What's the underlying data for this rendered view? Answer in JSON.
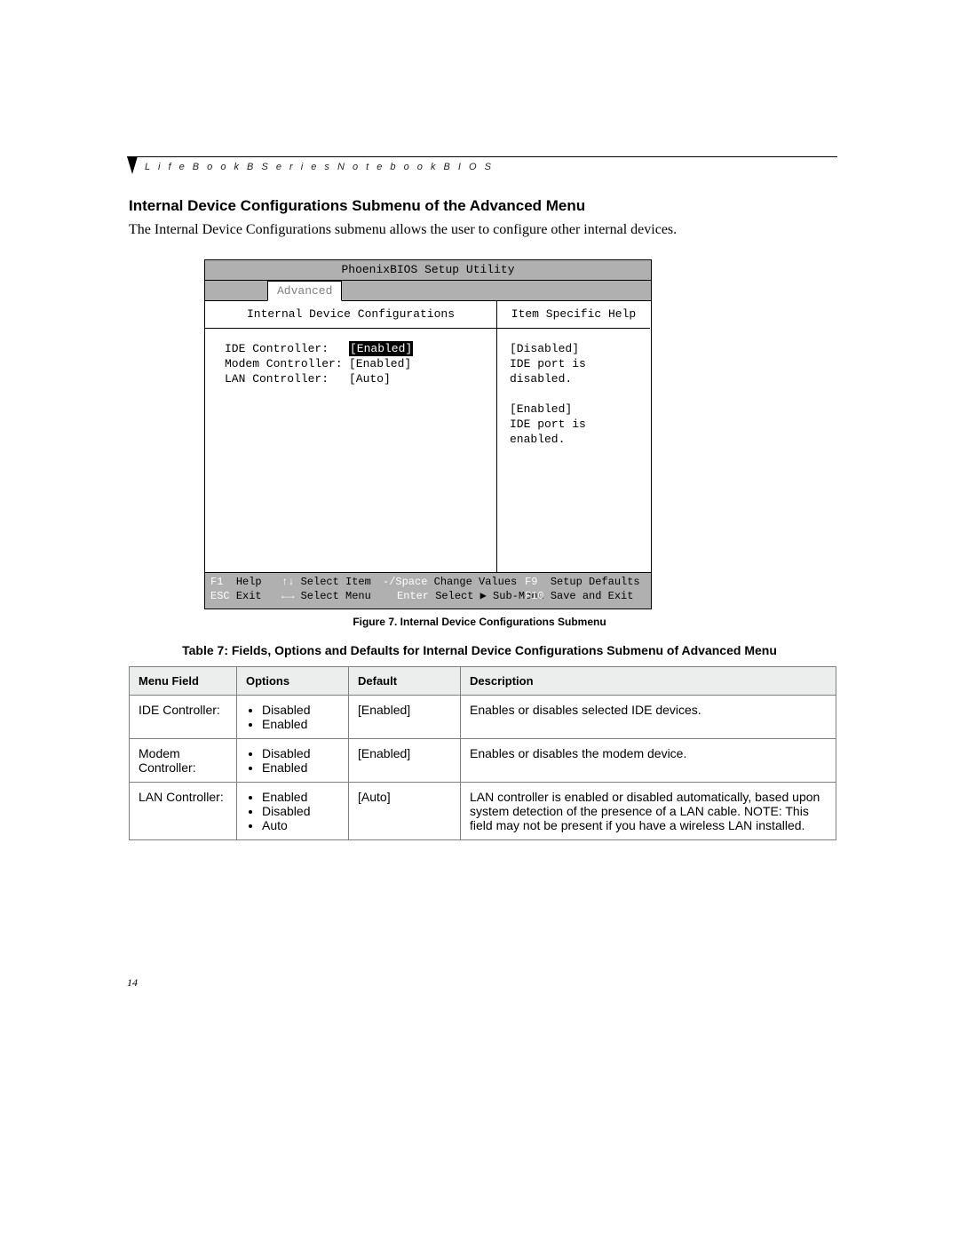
{
  "header": {
    "running_head": "L i f e B o o k   B   S e r i e s   N o t e b o o k   B I O S"
  },
  "section": {
    "title": "Internal Device Configurations Submenu of the Advanced Menu",
    "body": "The Internal Device Configurations submenu allows the user to configure other internal devices."
  },
  "bios": {
    "title": "PhoenixBIOS Setup Utility",
    "tab": "Advanced",
    "left_header": "Internal Device Configurations",
    "right_header": "Item Specific Help",
    "fields": [
      {
        "label": "IDE Controller:",
        "value": "[Enabled]",
        "selected": true
      },
      {
        "label": "Modem Controller:",
        "value": "[Enabled]",
        "selected": false
      },
      {
        "label": "LAN Controller:",
        "value": "[Auto]",
        "selected": false
      }
    ],
    "help": {
      "l1": "[Disabled]",
      "l2": "IDE port is disabled.",
      "l3": "[Enabled]",
      "l4": "IDE port is enabled."
    },
    "footer": {
      "f1_key": "F1",
      "f1_lbl": "Help",
      "ud_key": "↑↓",
      "ud_lbl": "Select Item",
      "pm_key": "-/Space",
      "pm_lbl": "Change Values",
      "f9_key": "F9",
      "f9_lbl": "Setup Defaults",
      "esc_key": "ESC",
      "esc_lbl": "Exit",
      "lr_key": "←→",
      "lr_lbl": "Select Menu",
      "en_key": "Enter",
      "en_lbl": "Select ▶ Sub-Menu",
      "f10_key": "F10",
      "f10_lbl": "Save and Exit"
    }
  },
  "figure_caption": "Figure 7.  Internal Device Configurations Submenu",
  "table_caption": "Table 7: Fields, Options and Defaults for Internal Device Configurations Submenu of Advanced Menu",
  "table": {
    "headers": {
      "c1": "Menu Field",
      "c2": "Options",
      "c3": "Default",
      "c4": "Description"
    },
    "rows": [
      {
        "field": "IDE Controller:",
        "options": [
          "Disabled",
          "Enabled"
        ],
        "default": "[Enabled]",
        "desc": "Enables or disables selected IDE devices."
      },
      {
        "field": "Modem Controller:",
        "options": [
          "Disabled",
          "Enabled"
        ],
        "default": "[Enabled]",
        "desc": "Enables or disables the modem device."
      },
      {
        "field": "LAN Controller:",
        "options": [
          "Enabled",
          "Disabled",
          "Auto"
        ],
        "default": "[Auto]",
        "desc": "LAN controller is enabled or disabled automatically, based upon system detection of the presence of a LAN cable. NOTE: This field may not be present if you have a wireless LAN installed."
      }
    ]
  },
  "page_number": "14"
}
